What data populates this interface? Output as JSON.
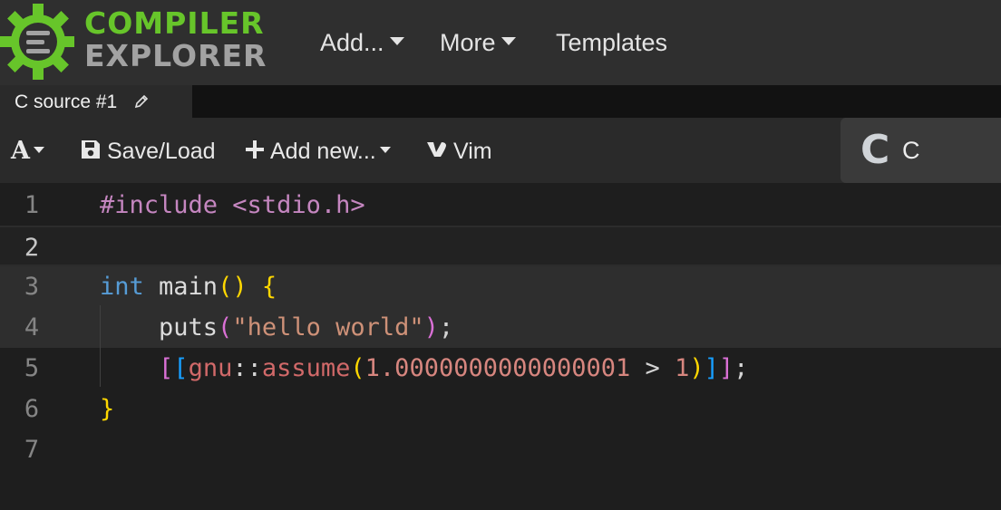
{
  "navbar": {
    "brand_top": "COMPILER",
    "brand_bottom": "EXPLORER",
    "menu": [
      {
        "label": "Add..."
      },
      {
        "label": "More"
      },
      {
        "label": "Templates"
      }
    ]
  },
  "tabs": [
    {
      "label": "C source #1"
    }
  ],
  "toolbar": {
    "font_button": "A",
    "save_load": "Save/Load",
    "add_new": "Add new...",
    "vim": "Vim"
  },
  "language": {
    "icon_text": "C",
    "name": "C"
  },
  "editor": {
    "line_numbers": [
      "1",
      "2",
      "3",
      "4",
      "5",
      "6",
      "7"
    ],
    "active_line": 2,
    "lines": [
      [
        {
          "t": "#include <stdio.h>",
          "c": "kw-pre"
        }
      ],
      [],
      [
        {
          "t": "int",
          "c": "type"
        },
        {
          "t": " main",
          "c": "ident"
        },
        {
          "t": "()",
          "c": "b1"
        },
        {
          "t": " ",
          "c": "punc"
        },
        {
          "t": "{",
          "c": "b1"
        }
      ],
      [
        {
          "t": "    puts",
          "c": "ident"
        },
        {
          "t": "(",
          "c": "b2"
        },
        {
          "t": "\"hello world\"",
          "c": "str"
        },
        {
          "t": ")",
          "c": "b2"
        },
        {
          "t": ";",
          "c": "punc"
        }
      ],
      [
        {
          "t": "    ",
          "c": "punc"
        },
        {
          "t": "[",
          "c": "b2"
        },
        {
          "t": "[",
          "c": "b3"
        },
        {
          "t": "gnu",
          "c": "fnpink"
        },
        {
          "t": "::",
          "c": "punc"
        },
        {
          "t": "assume",
          "c": "fnpink"
        },
        {
          "t": "(",
          "c": "b1"
        },
        {
          "t": "1.0000000000000001",
          "c": "num"
        },
        {
          "t": " > ",
          "c": "punc"
        },
        {
          "t": "1",
          "c": "num"
        },
        {
          "t": ")",
          "c": "b1"
        },
        {
          "t": "]",
          "c": "b3"
        },
        {
          "t": "]",
          "c": "b2"
        },
        {
          "t": ";",
          "c": "punc"
        }
      ],
      [
        {
          "t": "}",
          "c": "b1"
        }
      ],
      []
    ]
  },
  "colors": {
    "brand_green": "#67c52a",
    "brand_gray": "#a2a2a2",
    "navbar_bg": "#2f2f2f",
    "editor_bg": "#1e1e1e"
  }
}
